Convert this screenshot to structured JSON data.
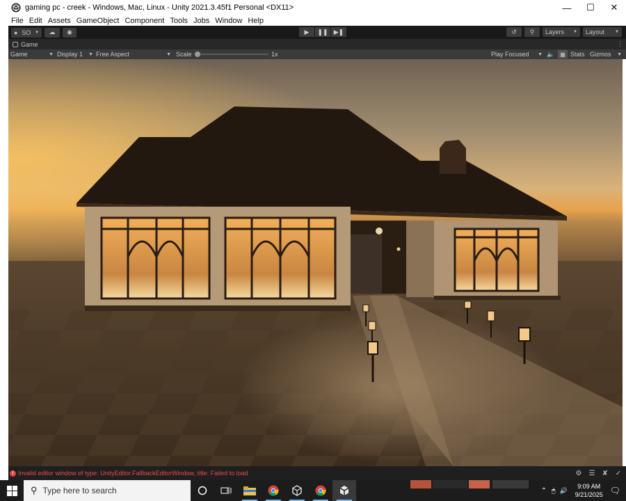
{
  "window": {
    "title": "gaming pc - creek - Windows, Mac, Linux - Unity 2021.3.45f1 Personal <DX11>",
    "controls": [
      "minimize",
      "maximize",
      "close"
    ]
  },
  "menu": [
    "File",
    "Edit",
    "Assets",
    "GameObject",
    "Component",
    "Tools",
    "Jobs",
    "Window",
    "Help"
  ],
  "toolbar": {
    "account_label": "SO",
    "layers_label": "Layers",
    "layout_label": "Layout"
  },
  "tab": {
    "label": "Game"
  },
  "gamebar": {
    "mode": "Game",
    "display": "Display 1",
    "aspect": "Free Aspect",
    "scale_label": "Scale",
    "scale_value": "1x",
    "play_focused": "Play Focused",
    "stats": "Stats",
    "gizmos": "Gizmos"
  },
  "status": {
    "error_text": "Invalid editor window of type: UnityEditor.FallbackEditorWindow, title: Failed to load"
  },
  "taskbar": {
    "search_placeholder": "Type here to search",
    "time": "9:09 AM",
    "date": "9/21/2025"
  },
  "colors": {
    "editor_dark": "#191919",
    "panel": "#3a3a3a",
    "error_red": "#e64b4b",
    "taskbar": "#1c1c1c"
  }
}
